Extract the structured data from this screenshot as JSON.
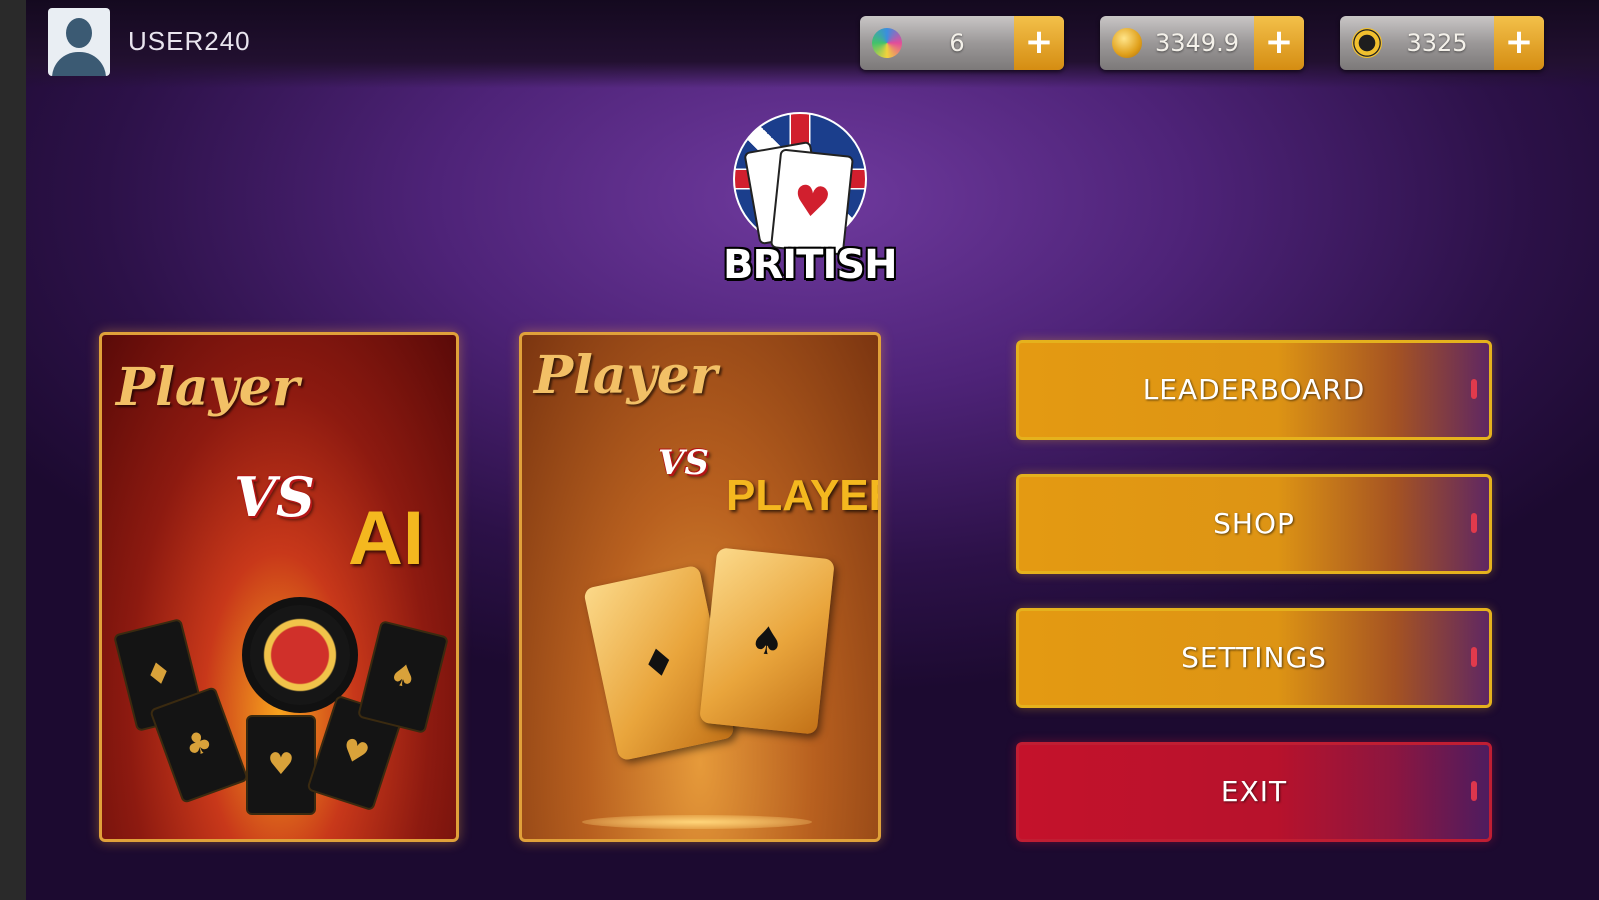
{
  "profile": {
    "username": "USER240",
    "avatar_icon": "user-silhouette-icon"
  },
  "resources": [
    {
      "icon": "gem-icon",
      "value": "6",
      "add": "+"
    },
    {
      "icon": "coin-icon",
      "value": "3349.9",
      "add": "+"
    },
    {
      "icon": "chip-icon",
      "value": "3325",
      "add": "+"
    }
  ],
  "logo": {
    "text": "BRITISH",
    "icon": "union-jack-playing-cards-logo",
    "heart": "♥"
  },
  "modes": {
    "ai": {
      "player": "Player",
      "vs": "VS",
      "opponent": "AI",
      "suits": [
        "♦",
        "♣",
        "♥",
        "♥",
        "♠"
      ]
    },
    "pvp": {
      "player": "Player",
      "vs": "VS",
      "opponent": "PLAYER",
      "suits": [
        "♦",
        "♠"
      ]
    }
  },
  "menu": {
    "leaderboard": "LEADERBOARD",
    "shop": "SHOP",
    "settings": "SETTINGS",
    "exit": "EXIT"
  },
  "colors": {
    "accent_gold": "#e49a12",
    "exit_red": "#c4122b",
    "background_purple": "#4e2378"
  }
}
